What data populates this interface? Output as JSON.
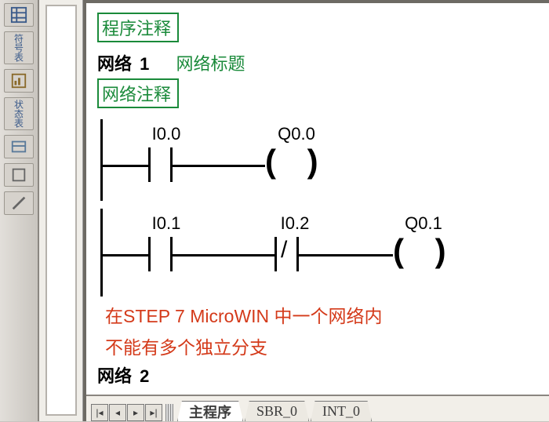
{
  "toolbar": {
    "icon1_label": "符号表",
    "icon2_label": "状态表"
  },
  "program": {
    "program_comment": "程序注释",
    "network1": {
      "label": "网络",
      "number": "1",
      "title": "网络标题",
      "comment": "网络注释",
      "rung1": {
        "contact1": "I0.0",
        "coil": "Q0.0"
      },
      "rung2": {
        "contact1": "I0.1",
        "contact2": "I0.2",
        "coil": "Q0.1"
      }
    },
    "annotation": {
      "line1": "在STEP 7 MicroWIN 中一个网络内",
      "line2": "不能有多个独立分支"
    },
    "network2": {
      "label": "网络",
      "number": "2"
    }
  },
  "tabs": {
    "main": "主程序",
    "sbr": "SBR_0",
    "int": "INT_0"
  }
}
